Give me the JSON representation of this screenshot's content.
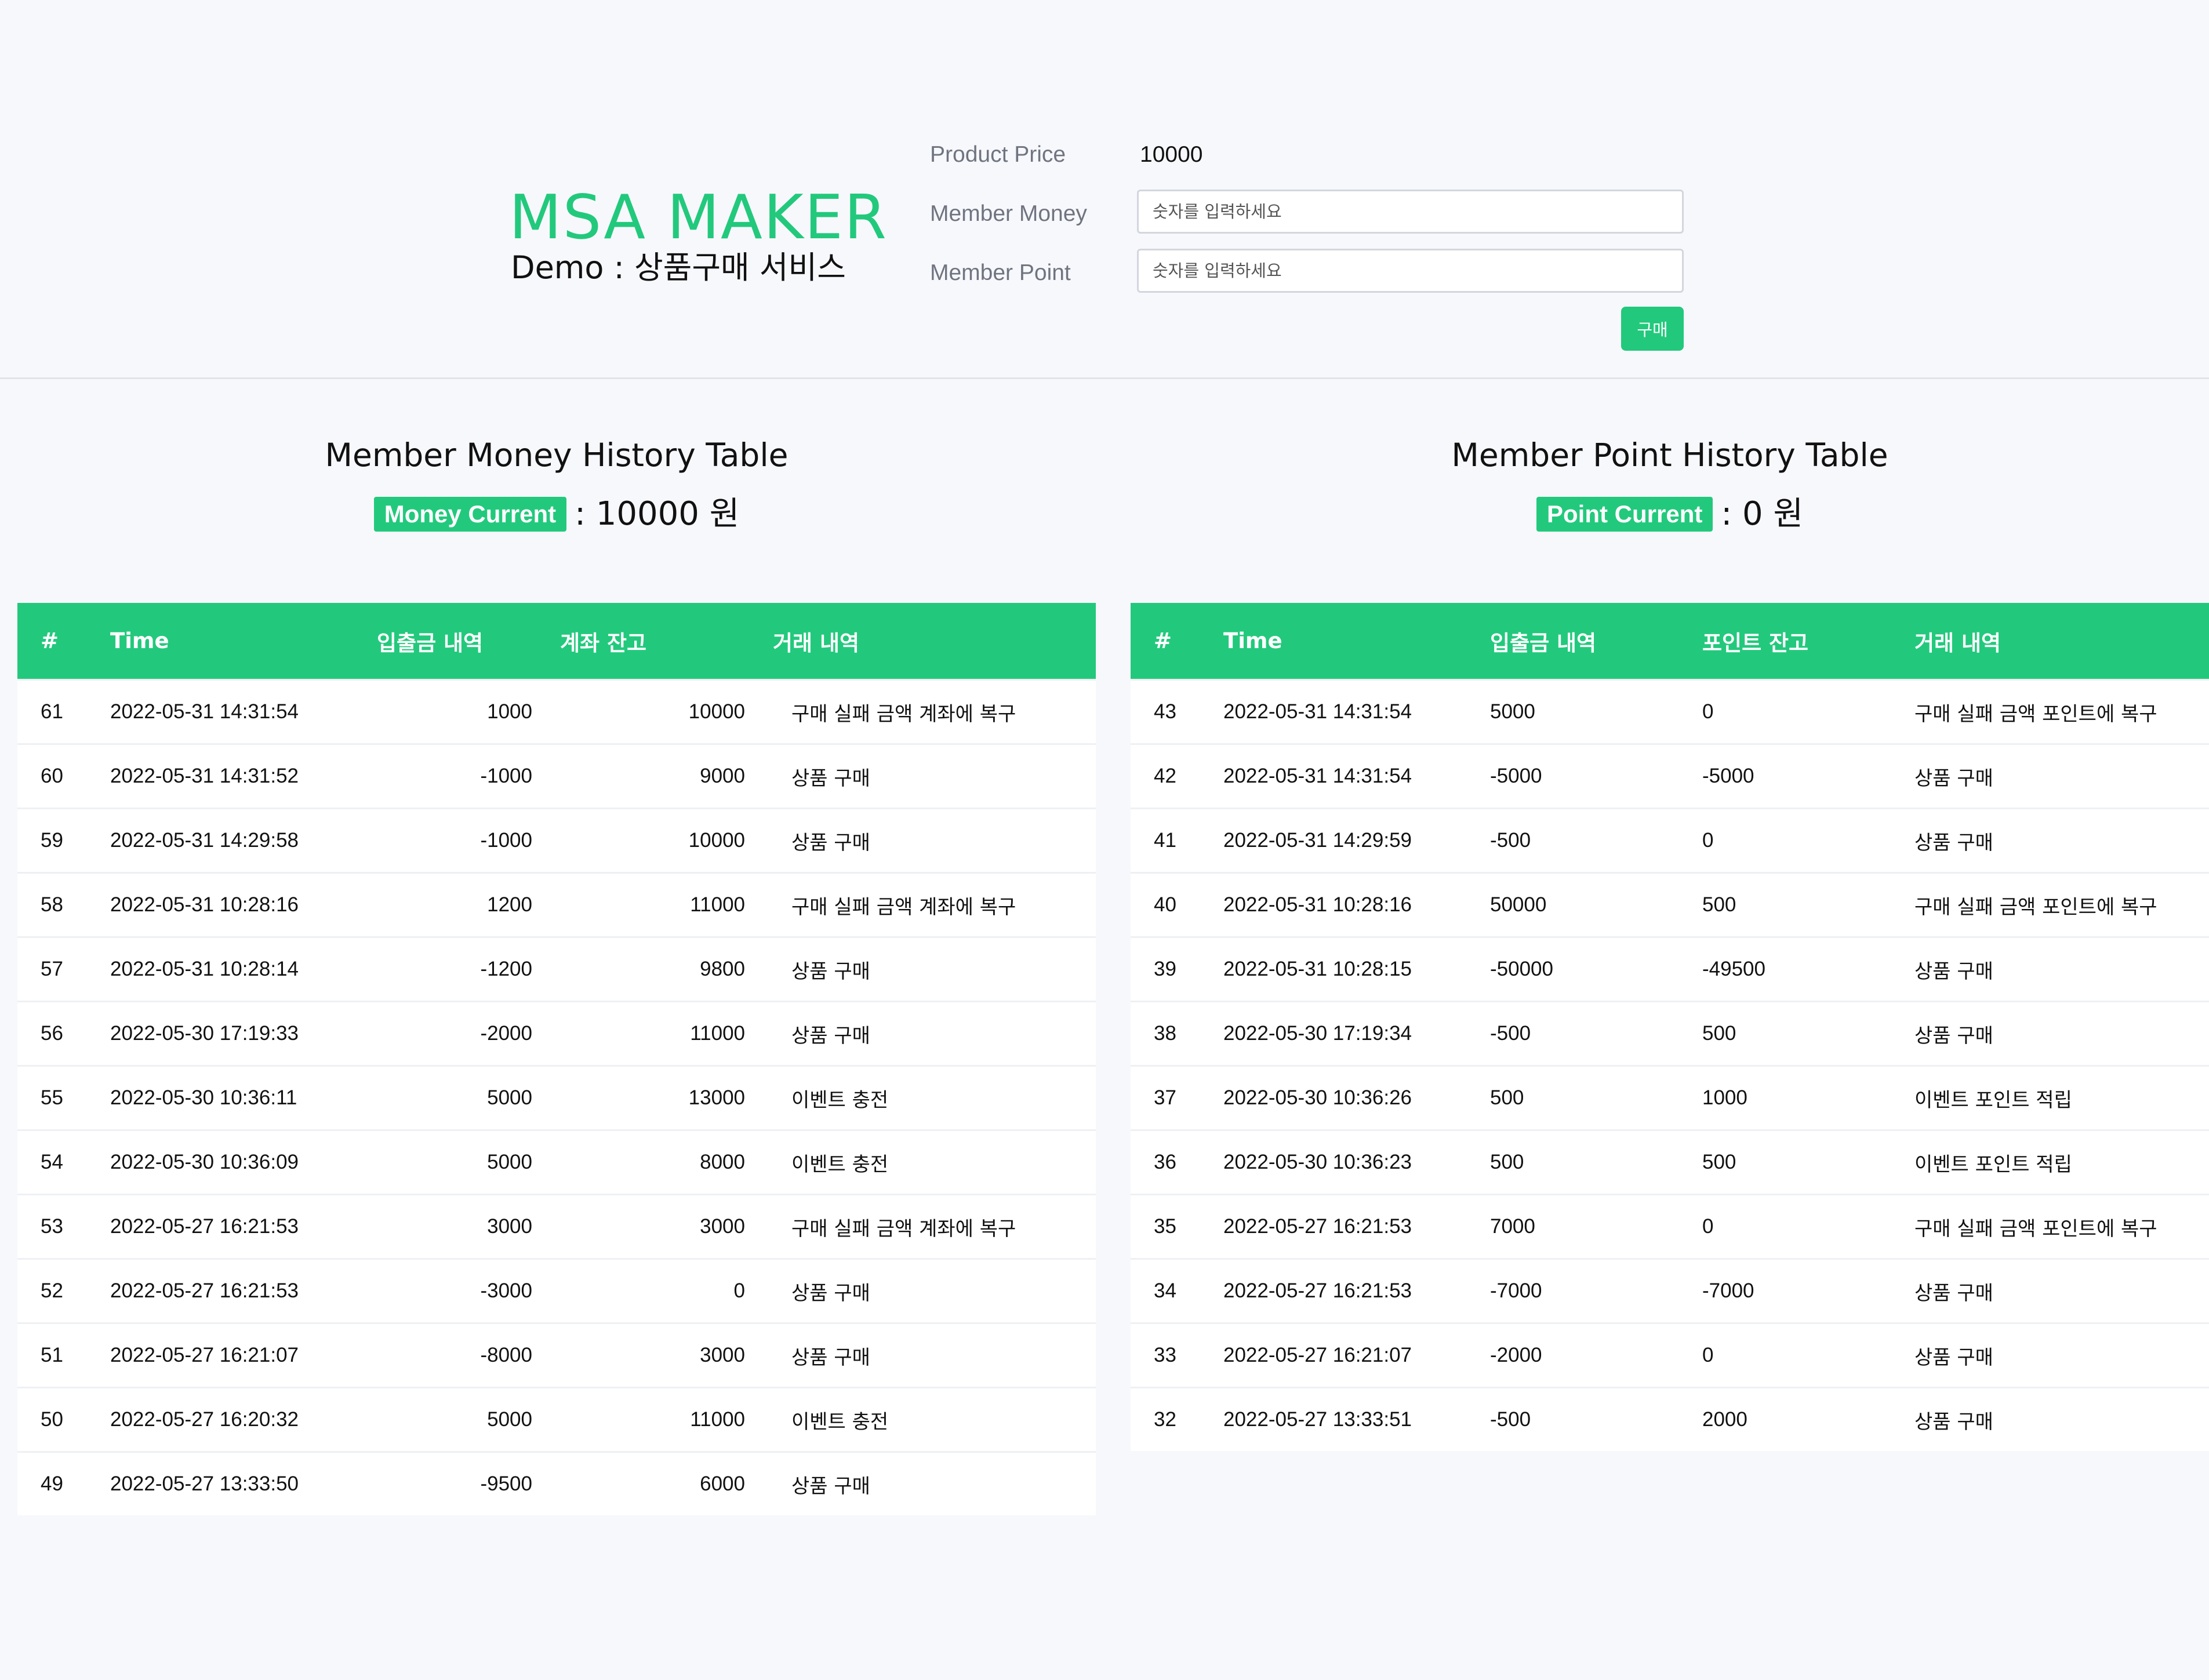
{
  "brand": {
    "logo": "MSA MAKER",
    "subtitle": "Demo : 상품구매 서비스"
  },
  "form": {
    "price_label": "Product Price",
    "price_value": "10000",
    "money_label": "Member Money",
    "money_placeholder": "숫자를 입력하세요",
    "point_label": "Member Point",
    "point_placeholder": "숫자를 입력하세요",
    "buy_label": "구매"
  },
  "money": {
    "title": "Member Money History Table",
    "badge": "Money Current",
    "current": ": 10000 원",
    "headers": [
      "#",
      "Time",
      "입출금 내역",
      "계좌 잔고",
      "거래 내역"
    ],
    "rows": [
      [
        "61",
        "2022-05-31 14:31:54",
        "1000",
        "10000",
        "구매 실패 금액 계좌에 복구"
      ],
      [
        "60",
        "2022-05-31 14:31:52",
        "-1000",
        "9000",
        "상품 구매"
      ],
      [
        "59",
        "2022-05-31 14:29:58",
        "-1000",
        "10000",
        "상품 구매"
      ],
      [
        "58",
        "2022-05-31 10:28:16",
        "1200",
        "11000",
        "구매 실패 금액 계좌에 복구"
      ],
      [
        "57",
        "2022-05-31 10:28:14",
        "-1200",
        "9800",
        "상품 구매"
      ],
      [
        "56",
        "2022-05-30 17:19:33",
        "-2000",
        "11000",
        "상품 구매"
      ],
      [
        "55",
        "2022-05-30 10:36:11",
        "5000",
        "13000",
        "이벤트 충전"
      ],
      [
        "54",
        "2022-05-30 10:36:09",
        "5000",
        "8000",
        "이벤트 충전"
      ],
      [
        "53",
        "2022-05-27 16:21:53",
        "3000",
        "3000",
        "구매 실패 금액 계좌에 복구"
      ],
      [
        "52",
        "2022-05-27 16:21:53",
        "-3000",
        "0",
        "상품 구매"
      ],
      [
        "51",
        "2022-05-27 16:21:07",
        "-8000",
        "3000",
        "상품 구매"
      ],
      [
        "50",
        "2022-05-27 16:20:32",
        "5000",
        "11000",
        "이벤트 충전"
      ],
      [
        "49",
        "2022-05-27 13:33:50",
        "-9500",
        "6000",
        "상품 구매"
      ]
    ]
  },
  "point": {
    "title": "Member Point History Table",
    "badge": "Point Current",
    "current": ": 0 원",
    "headers": [
      "#",
      "Time",
      "입출금 내역",
      "포인트 잔고",
      "거래 내역"
    ],
    "rows": [
      [
        "43",
        "2022-05-31 14:31:54",
        "5000",
        "0",
        "구매 실패 금액 포인트에 복구"
      ],
      [
        "42",
        "2022-05-31 14:31:54",
        "-5000",
        "-5000",
        "상품 구매"
      ],
      [
        "41",
        "2022-05-31 14:29:59",
        "-500",
        "0",
        "상품 구매"
      ],
      [
        "40",
        "2022-05-31 10:28:16",
        "50000",
        "500",
        "구매 실패 금액 포인트에 복구"
      ],
      [
        "39",
        "2022-05-31 10:28:15",
        "-50000",
        "-49500",
        "상품 구매"
      ],
      [
        "38",
        "2022-05-30 17:19:34",
        "-500",
        "500",
        "상품 구매"
      ],
      [
        "37",
        "2022-05-30 10:36:26",
        "500",
        "1000",
        "이벤트 포인트 적립"
      ],
      [
        "36",
        "2022-05-30 10:36:23",
        "500",
        "500",
        "이벤트 포인트 적립"
      ],
      [
        "35",
        "2022-05-27 16:21:53",
        "7000",
        "0",
        "구매 실패 금액 포인트에 복구"
      ],
      [
        "34",
        "2022-05-27 16:21:53",
        "-7000",
        "-7000",
        "상품 구매"
      ],
      [
        "33",
        "2022-05-27 16:21:07",
        "-2000",
        "0",
        "상품 구매"
      ],
      [
        "32",
        "2022-05-27 13:33:51",
        "-500",
        "2000",
        "상품 구매"
      ]
    ]
  },
  "colors": {
    "accent": "#22c97c",
    "background": "#f7f8fc"
  }
}
